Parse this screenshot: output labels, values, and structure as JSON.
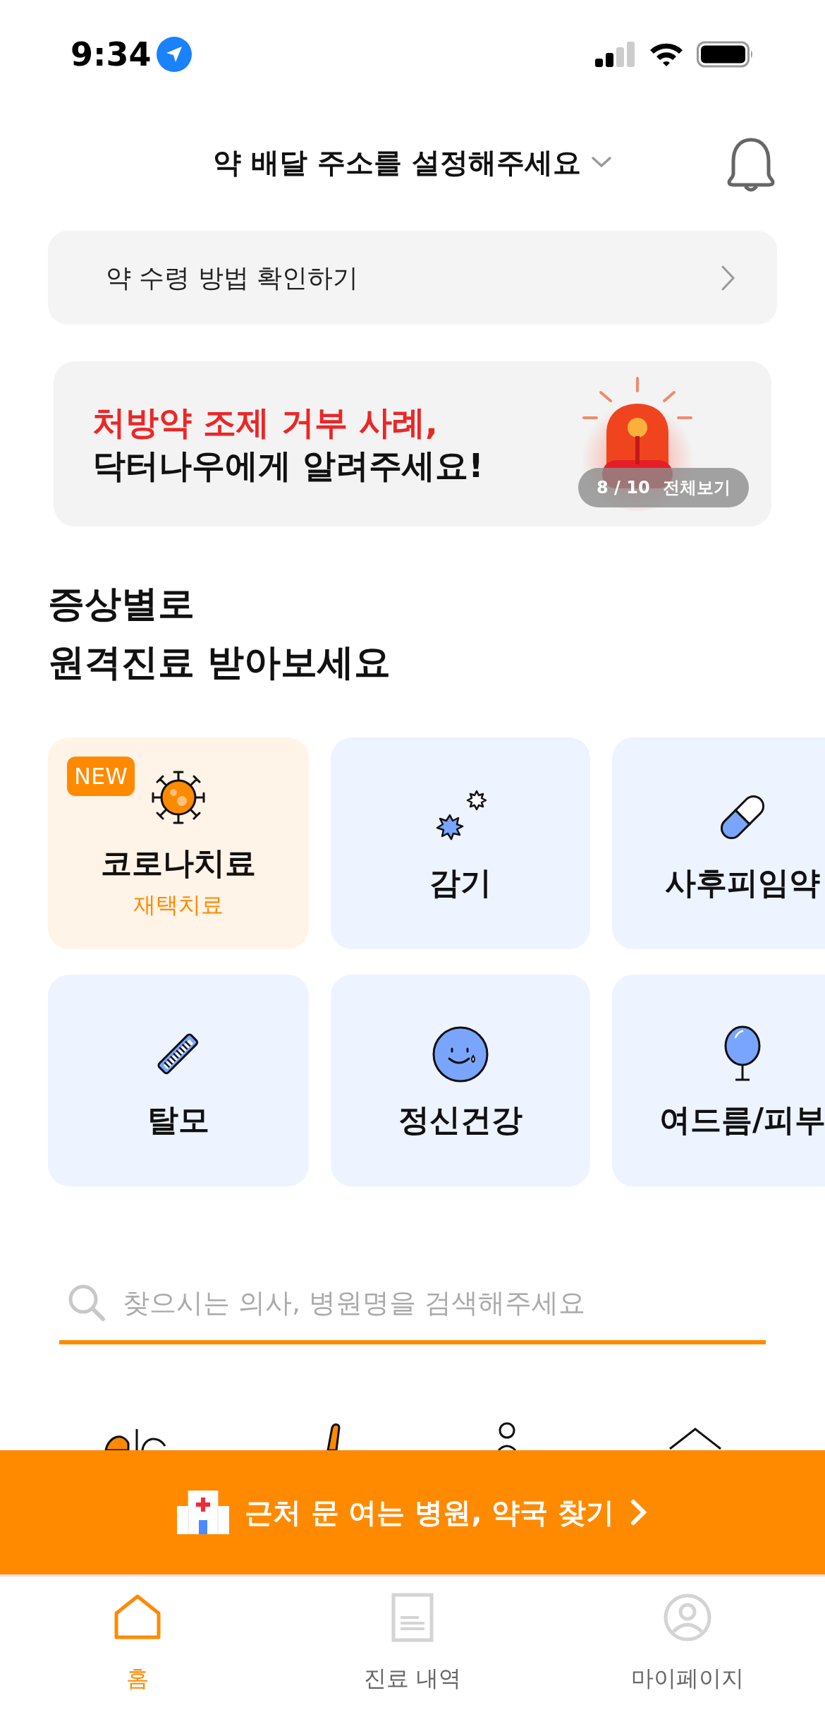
{
  "status_bar": {
    "time": "9:34"
  },
  "header": {
    "title": "약 배달 주소를 설정해주세요"
  },
  "notice": {
    "label": "약 수령 방법 확인하기"
  },
  "banner": {
    "headline": "처방약 조제 거부 사례,",
    "subline": "닥터나우에게 알려주세요!",
    "counter": "8 / 10",
    "view_all": "전체보기"
  },
  "section": {
    "title_lines": [
      "증상별로",
      "원격진료 받아보세요"
    ]
  },
  "categories": [
    {
      "label": "코로나치료",
      "sublabel": "재택치료",
      "badge": "NEW",
      "highlighted": true
    },
    {
      "label": "감기",
      "highlighted": false
    },
    {
      "label": "사후피임약",
      "highlighted": false
    },
    {
      "label": "탈모",
      "highlighted": false
    },
    {
      "label": "정신건강",
      "highlighted": false
    },
    {
      "label": "여드름/피부",
      "highlighted": false
    }
  ],
  "search": {
    "placeholder": "찾으시는 의사, 병원명을 검색해주세요"
  },
  "cta": {
    "label": "근처 문 여는 병원, 약국 찾기"
  },
  "tabs": [
    {
      "label": "홈",
      "selected": true
    },
    {
      "label": "진료 내역",
      "selected": false
    },
    {
      "label": "마이페이지",
      "selected": false
    }
  ]
}
